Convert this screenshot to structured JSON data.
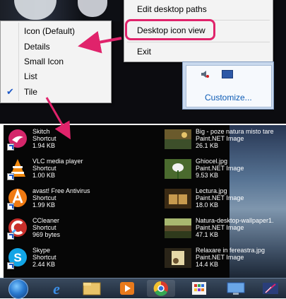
{
  "context_menu": {
    "items": [
      "Edit desktop paths",
      "Desktop icon view",
      "Exit"
    ]
  },
  "icon_view_submenu": {
    "items": [
      "Icon (Default)",
      "Details",
      "Small Icon",
      "List",
      "Tile"
    ],
    "checked": "Tile"
  },
  "tray": {
    "customize_label": "Customize..."
  },
  "desktop_icons": {
    "left": [
      {
        "name": "Skitch",
        "type": "Shortcut",
        "size": "1.94 KB",
        "icon": "skitch-icon"
      },
      {
        "name": "VLC media player",
        "type": "Shortcut",
        "size": "1.00 KB",
        "icon": "vlc-icon"
      },
      {
        "name": "avast! Free Antivirus",
        "type": "Shortcut",
        "size": "1.99 KB",
        "icon": "avast-icon"
      },
      {
        "name": "CCleaner",
        "type": "Shortcut",
        "size": "969 bytes",
        "icon": "ccleaner-icon"
      },
      {
        "name": "Skype",
        "type": "Shortcut",
        "size": "2.44 KB",
        "icon": "skype-icon"
      }
    ],
    "right": [
      {
        "name": "Big - poze natura misto tare",
        "type": "Paint.NET Image",
        "size": "26.1 KB",
        "icon": "image-thumbnail"
      },
      {
        "name": "Ghiocel.jpg",
        "type": "Paint.NET Image",
        "size": "9.53 KB",
        "icon": "image-thumbnail"
      },
      {
        "name": "Lectura.jpg",
        "type": "Paint.NET Image",
        "size": "18.0 KB",
        "icon": "image-thumbnail"
      },
      {
        "name": "Natura-desktop-wallpaper1.",
        "type": "Paint.NET Image",
        "size": "47.1 KB",
        "icon": "image-thumbnail"
      },
      {
        "name": "Relaxare in fereastra.jpg",
        "type": "Paint.NET Image",
        "size": "14.4 KB",
        "icon": "image-thumbnail"
      }
    ]
  },
  "taskbar": {
    "icons": [
      "start-orb-icon",
      "internet-explorer-icon",
      "file-explorer-icon",
      "media-player-icon",
      "chrome-icon",
      "apps-grid-icon",
      "remote-desktop-icon",
      "paint-icon"
    ]
  },
  "colors": {
    "highlight": "#e0236b",
    "check": "#1b57c7",
    "link": "#0c5bb5"
  }
}
